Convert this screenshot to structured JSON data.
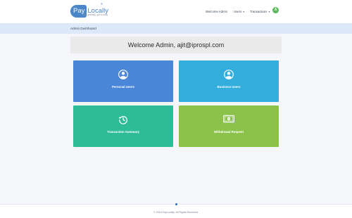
{
  "header": {
    "logo_text_left": "Pay",
    "logo_text_right": "Locally",
    "logo_tagline": "Pay globally, get locally",
    "nav": [
      {
        "label": "Welcome Admin"
      },
      {
        "label": "Users"
      },
      {
        "label": "Transactions"
      }
    ],
    "avatar_letter": "A"
  },
  "breadcrumb": {
    "label": "Admin Dashboard"
  },
  "welcome": {
    "text": "Welcome Admin, ajit@iprospl.com"
  },
  "cards": [
    {
      "label": "Personal Users",
      "icon": "user-circle-icon",
      "color": "#4a86d8"
    },
    {
      "label": "Business Users",
      "icon": "user-circle-icon",
      "color": "#33addb"
    },
    {
      "label": "Transaction Summary",
      "icon": "history-icon",
      "color": "#2ebc98"
    },
    {
      "label": "Withdrawal Request",
      "icon": "money-bill-icon",
      "color": "#8bc34a"
    }
  ],
  "footer": {
    "copyright": "© 2018 PayLocally. All Rights Reserved."
  }
}
